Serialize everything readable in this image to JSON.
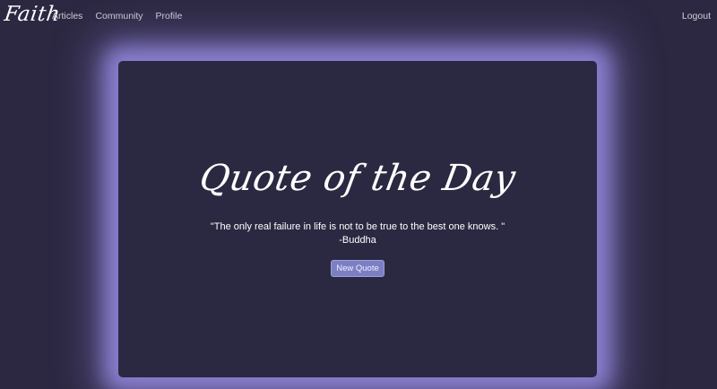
{
  "nav": {
    "brand": "Faith",
    "links": [
      "Articles",
      "Community",
      "Profile"
    ],
    "logout": "Logout"
  },
  "quote_card": {
    "title": "Quote of the Day",
    "text": "\"The only real failure in life is not to be true to the best one knows. \"",
    "author": "-Buddha",
    "button_label": "New Quote"
  },
  "colors": {
    "background": "#2c2842",
    "card_glow": "#8a7fd0",
    "button": "#7d7fc4"
  }
}
